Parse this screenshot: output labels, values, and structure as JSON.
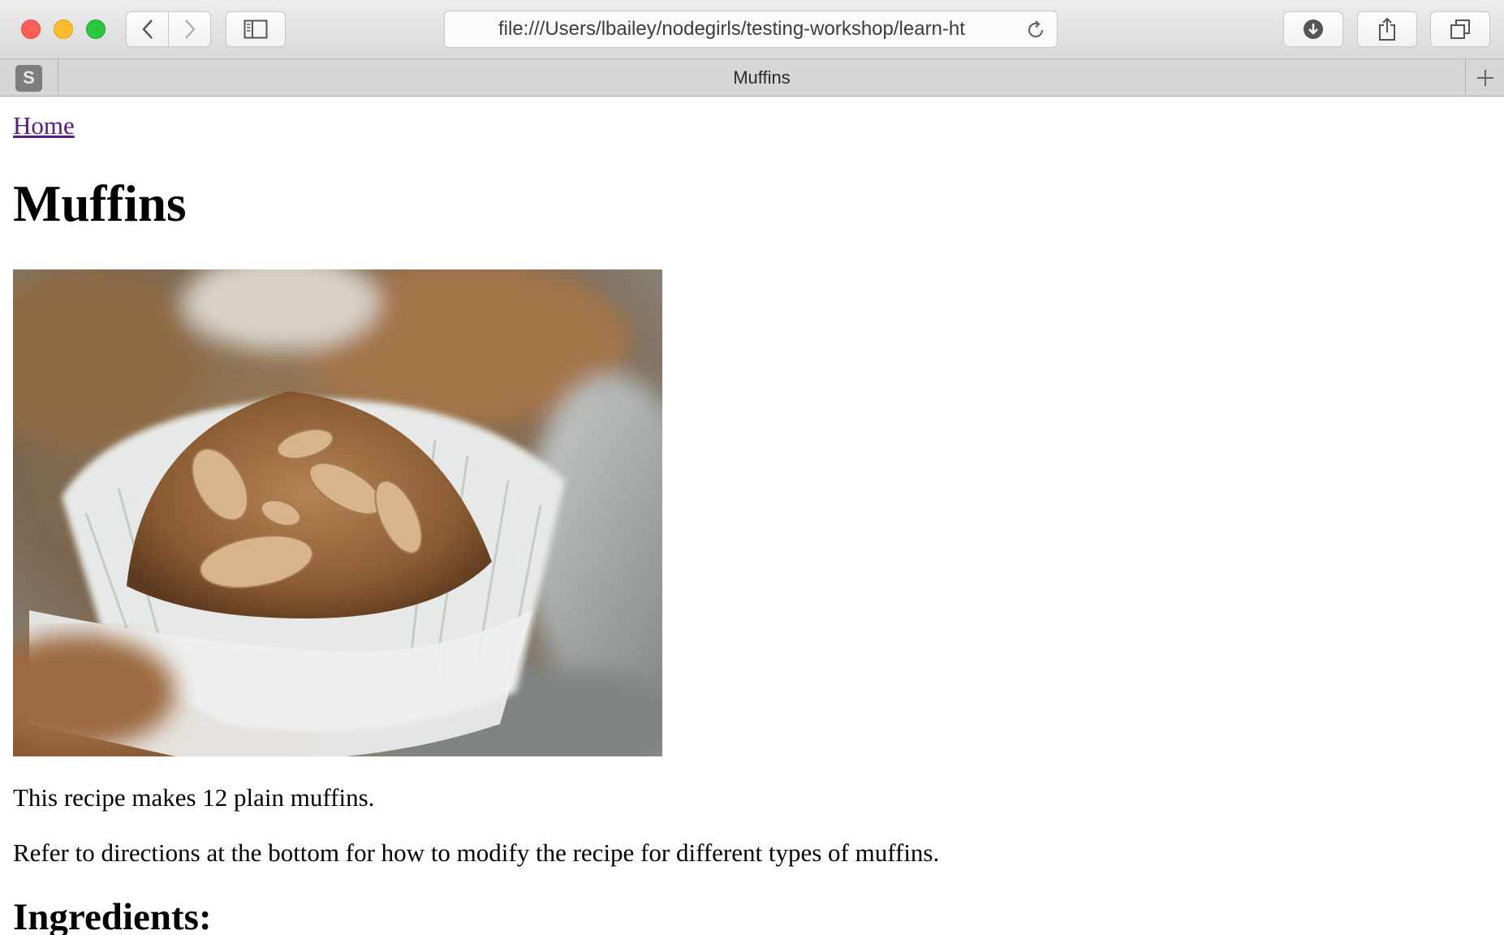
{
  "browser": {
    "url": "file:///Users/lbailey/nodegirls/testing-workshop/learn-ht",
    "pinned_tab_letter": "S",
    "active_tab_title": "Muffins"
  },
  "page": {
    "home_link": "Home",
    "title": "Muffins",
    "intro_1": "This recipe makes 12 plain muffins.",
    "intro_2": "Refer to directions at the bottom for how to modify the recipe for different types of muffins.",
    "section_heading": "Ingredients:"
  },
  "colors": {
    "link_visited": "#551a8b",
    "close": "#fc5f57",
    "minimize": "#fdbc2e",
    "zoom": "#2ac840"
  },
  "icons": [
    "close-icon",
    "minimize-icon",
    "zoom-icon",
    "back-icon",
    "forward-icon",
    "sidebar-icon",
    "reload-icon",
    "download-icon",
    "share-icon",
    "tabs-overview-icon",
    "new-tab-icon"
  ]
}
